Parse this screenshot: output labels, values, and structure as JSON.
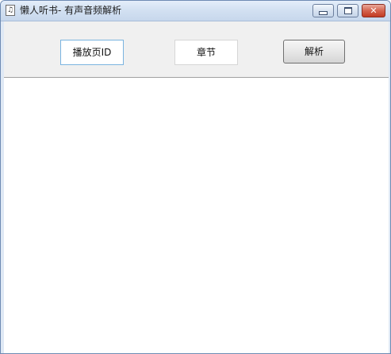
{
  "window": {
    "title": "懒人听书- 有声音频解析",
    "icon": "music-note-icon",
    "controls": {
      "minimize": "minimize-icon",
      "maximize": "maximize-icon",
      "close": "close-icon",
      "close_glyph": "✕"
    },
    "colors": {
      "frame": "#6e8bb3",
      "close": "#c23b22",
      "toolbar": "#f0f0f0"
    }
  },
  "toolbar": {
    "play_page_id_value": "播放页ID",
    "chapter_value": "章节",
    "parse_label": "解析"
  }
}
